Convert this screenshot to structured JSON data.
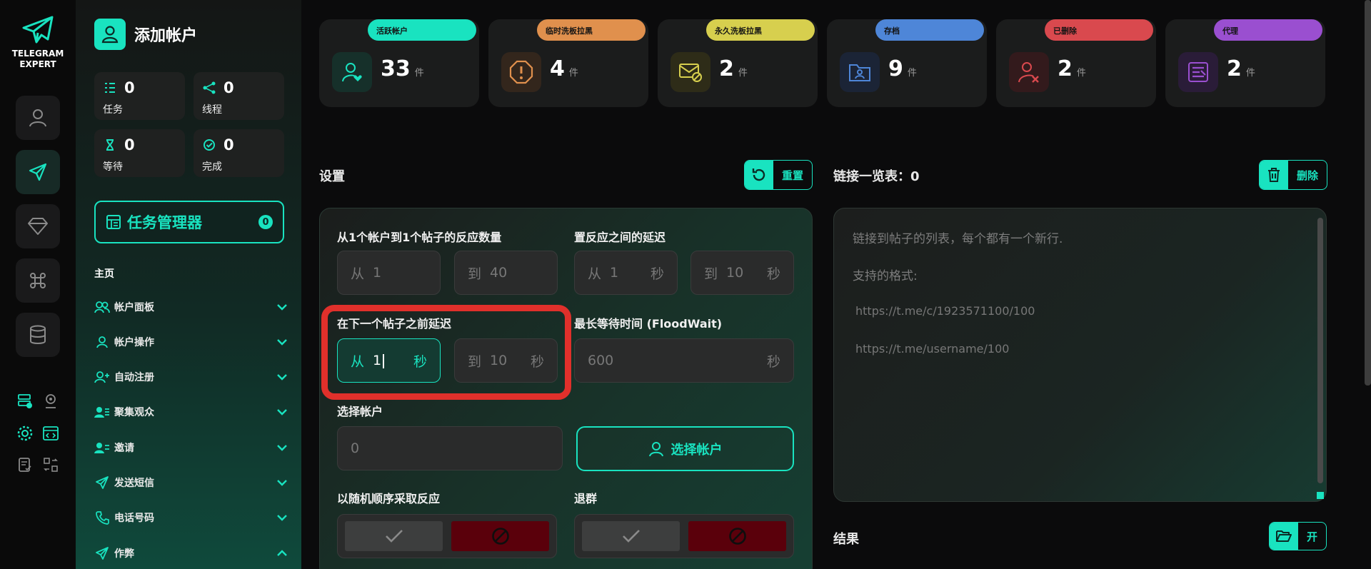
{
  "app": {
    "logo_line1": "TELEGRAM",
    "logo_line2": "EXPERT",
    "accent": "#19e3c0"
  },
  "rail": {
    "icons": [
      "user-icon",
      "send-icon",
      "diamond-icon",
      "command-icon",
      "database-icon"
    ]
  },
  "sidebar": {
    "title": "添加帐户",
    "stats": [
      {
        "value": "0",
        "label": "任务",
        "icon": "list-icon"
      },
      {
        "value": "0",
        "label": "线程",
        "icon": "share-icon"
      },
      {
        "value": "0",
        "label": "等待",
        "icon": "hourglass-icon"
      },
      {
        "value": "0",
        "label": "完成",
        "icon": "check-circle-icon"
      }
    ],
    "task_manager": {
      "label": "任务管理器",
      "count": "0"
    },
    "section_label": "主页",
    "menu": [
      {
        "label": "帐户面板",
        "icon": "users-icon"
      },
      {
        "label": "帐户操作",
        "icon": "user-icon"
      },
      {
        "label": "自动注册",
        "icon": "user-plus-icon"
      },
      {
        "label": "聚集观众",
        "icon": "audience-icon"
      },
      {
        "label": "邀请",
        "icon": "invite-icon"
      },
      {
        "label": "发送短信",
        "icon": "send-icon"
      },
      {
        "label": "电话号码",
        "icon": "phone-icon"
      },
      {
        "label": "作弊",
        "icon": "send-icon"
      }
    ]
  },
  "accounts": [
    {
      "tag": "活跃帐户",
      "count": "33",
      "unit": "件",
      "color": "#19e3c0",
      "icon": "user-heart-icon"
    },
    {
      "tag": "临时洗板拉黑",
      "count": "4",
      "unit": "件",
      "color": "#e0904d",
      "icon": "alert-icon"
    },
    {
      "tag": "永久洗板拉黑",
      "count": "2",
      "unit": "件",
      "color": "#d7cf4e",
      "icon": "mail-blocked-icon"
    },
    {
      "tag": "存档",
      "count": "9",
      "unit": "件",
      "color": "#4e86d8",
      "icon": "folder-user-icon"
    },
    {
      "tag": "已删除",
      "count": "2",
      "unit": "件",
      "color": "#d9494e",
      "icon": "user-x-icon"
    },
    {
      "tag": "代理",
      "count": "2",
      "unit": "件",
      "color": "#9a4fd0",
      "icon": "proxy-icon"
    }
  ],
  "settings": {
    "title": "设置",
    "reset_label": "重置",
    "reactions_label": "从1个帐户到1个帖子的反应数量",
    "reactions_from": {
      "prefix": "从",
      "value": "1"
    },
    "reactions_to": {
      "prefix": "到",
      "value": "40"
    },
    "delay_label": "置反应之间的延迟",
    "delay_from": {
      "prefix": "从",
      "value": "1",
      "suffix": "秒"
    },
    "delay_to": {
      "prefix": "到",
      "value": "10",
      "suffix": "秒"
    },
    "next_delay_label": "在下一个帖子之前延迟",
    "next_from": {
      "prefix": "从",
      "value": "1",
      "suffix": "秒"
    },
    "next_to": {
      "prefix": "到",
      "value": "10",
      "suffix": "秒"
    },
    "floodwait_label": "最长等待时间 (FloodWait)",
    "floodwait": {
      "value": "600",
      "suffix": "秒"
    },
    "select_label": "选择帐户",
    "select_value": "0",
    "select_button": "选择帐户",
    "random_label": "以随机顺序采取反应",
    "leave_label": "退群"
  },
  "links": {
    "title": "链接一览表：0",
    "delete_label": "删除",
    "placeholder_line1": "链接到帖子的列表，每个都有一个新行.",
    "placeholder_line2": "支持的格式:",
    "example1": "https://t.me/c/1923571100/100",
    "example2": "https://t.me/username/100"
  },
  "results": {
    "title": "结果",
    "open_label": "开"
  }
}
